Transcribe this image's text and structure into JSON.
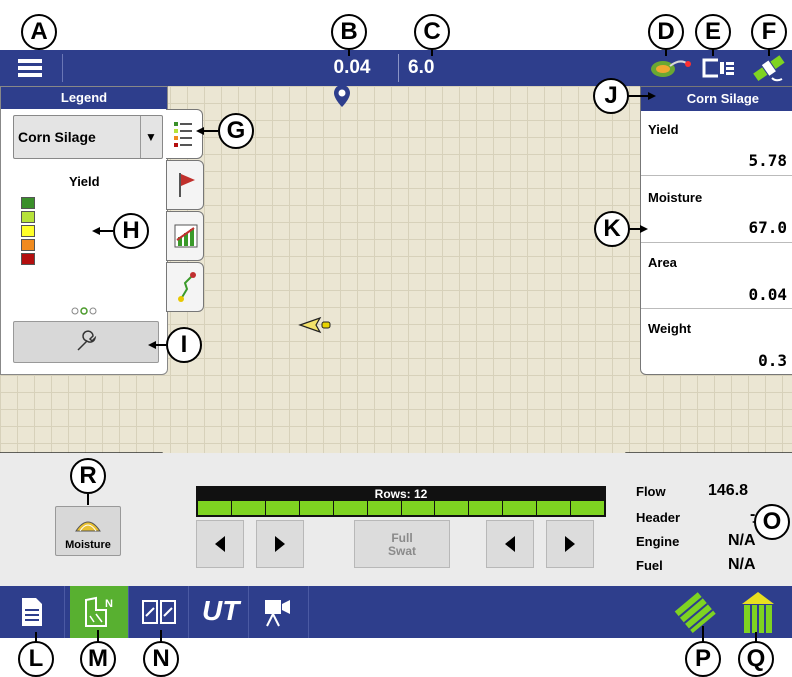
{
  "callouts": [
    "A",
    "B",
    "C",
    "D",
    "E",
    "F",
    "G",
    "H",
    "I",
    "J",
    "K",
    "L",
    "M",
    "N",
    "O",
    "P",
    "Q",
    "R"
  ],
  "topbar": {
    "value_b": "0.04",
    "value_c": "6.0"
  },
  "legend": {
    "title": "Legend",
    "dropdown_value": "Corn Silage",
    "section_title": "Yield",
    "colors": [
      "#3a8f2a",
      "#b6e23a",
      "#ffff2a",
      "#f08a1e",
      "#b40f0f"
    ]
  },
  "right_panel": {
    "title": "Corn Silage",
    "items": [
      {
        "label": "Yield",
        "value": "5.78"
      },
      {
        "label": "Moisture",
        "value": "67.0"
      },
      {
        "label": "Area",
        "value": "0.04"
      },
      {
        "label": "Weight",
        "value": "0.3"
      }
    ]
  },
  "bottom": {
    "moisture_label": "Moisture",
    "rows_label": "Rows: 12",
    "row_segments": 12,
    "full_swath_label_1": "Full",
    "full_swath_label_2": "Swat",
    "readouts": [
      {
        "label": "Flow",
        "value": "146.8"
      },
      {
        "label": "Header",
        "value": "-"
      },
      {
        "label": "Engine",
        "value": "N/A"
      },
      {
        "label": "Fuel",
        "value": "N/A"
      }
    ]
  },
  "navbar": {
    "ut_label": "UT"
  },
  "colors": {
    "bar": "#2e3e8c",
    "active_tab": "#58b030",
    "map_bg": "#ebe6d3",
    "bright_green": "#7ed321"
  }
}
